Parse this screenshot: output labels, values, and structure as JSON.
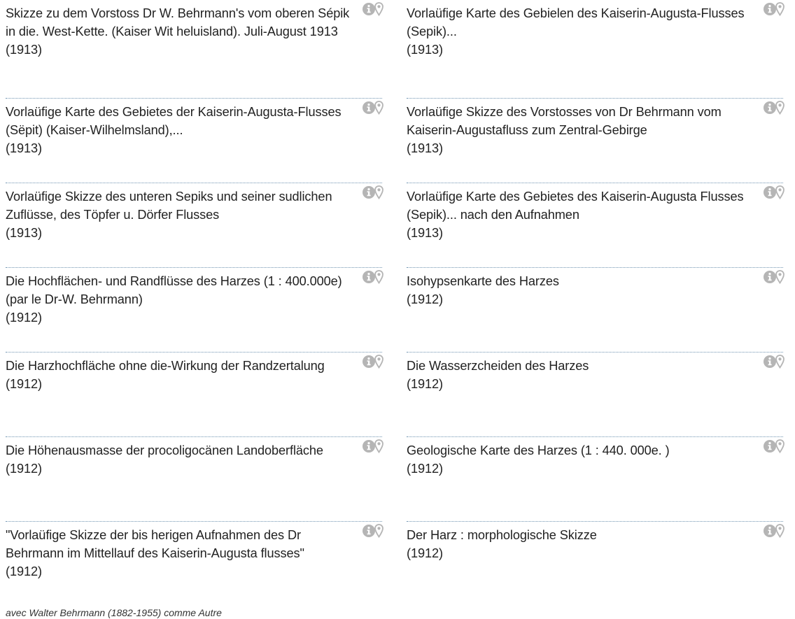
{
  "left_column": [
    {
      "title": "Skizze zu dem Vorstoss Dr W. Behrmann's vom oberen Sépik in die. West-Kette. (Kaiser Wit heluisland). Juli-August 1913",
      "year": "(1913)"
    },
    {
      "title": "Vorlaüfige Karte des Gebietes der Kaiserin-Augusta-Flusses (Sëpit) (Kaiser-Wilhelmsland),...",
      "year": "(1913)"
    },
    {
      "title": "Vorlaüfige Skizze des unteren Sepiks und seiner sudlichen Zuflüsse, des Töpfer u. Dörfer Flusses",
      "year": "(1913)"
    },
    {
      "title": "Die Hochflächen- und Randflüsse des Harzes (1 : 400.000e) (par le Dr-W. Behrmann)",
      "year": "(1912)"
    },
    {
      "title": "Die Harzhochfläche ohne die-Wirkung der Randzertalung",
      "year": "(1912)"
    },
    {
      "title": "Die Höhenausmasse der procoligocänen Landoberfläche",
      "year": "(1912)"
    },
    {
      "title": "\"Vorlaüfige Skizze der bis herigen Aufnahmen des Dr Behrmann im Mittellauf des Kaiserin-Augusta flusses\"",
      "year": "(1912)"
    }
  ],
  "right_column": [
    {
      "title": "Vorlaüfige Karte des Gebielen des Kaiserin-Augusta-Flusses (Sepik)...",
      "year": "(1913)"
    },
    {
      "title": "Vorlaüfige Skizze des Vorstosses von Dr Behrmann vom Kaiserin-Augustafluss zum Zentral-Gebirge",
      "year": "(1913)"
    },
    {
      "title": "Vorlaüfige Karte des Gebietes des Kaiserin-Augusta Flusses (Sepik)... nach den Aufnahmen",
      "year": "(1913)"
    },
    {
      "title": "Isohypsenkarte des Harzes",
      "year": "(1912)"
    },
    {
      "title": "Die Wasserzcheiden des Harzes",
      "year": "(1912)"
    },
    {
      "title": "Geologische Karte des Harzes (1 : 440. 000e. )",
      "year": "(1912)"
    },
    {
      "title": "Der Harz : morphologische Skizze",
      "year": "(1912)"
    }
  ],
  "footnote": "avec Walter Behrmann (1882-1955) comme Autre",
  "colors": {
    "icon": "#b5b5b5",
    "divider": "#6f93b0",
    "text": "#222222"
  },
  "icons": {
    "info": "info-icon",
    "location": "map-pin-icon"
  }
}
